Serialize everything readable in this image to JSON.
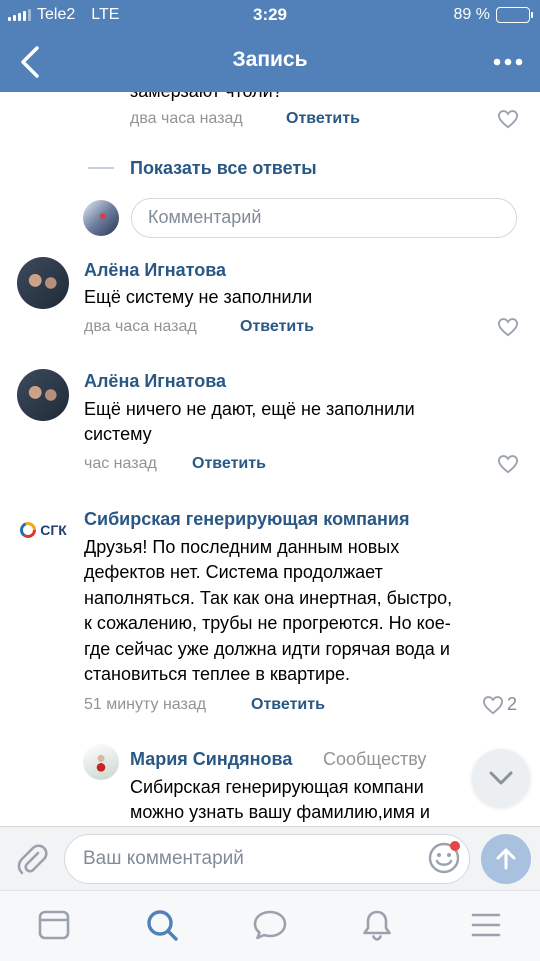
{
  "status_bar": {
    "carrier": "Tele2",
    "network": "LTE",
    "time": "3:29",
    "battery": "89 %",
    "battery_level": 0.89
  },
  "nav": {
    "title": "Запись"
  },
  "feed": {
    "top_partial": {
      "text": "замерзают чтоли?",
      "time": "два часа назад",
      "reply": "Ответить"
    },
    "show_all_replies": "Показать все ответы",
    "reply_placeholder": "Комментарий",
    "comments": [
      {
        "author": "Алёна Игнатова",
        "text": "Ещё систему не заполнили",
        "time": "два часа назад",
        "reply": "Ответить"
      },
      {
        "author": "Алёна Игнатова",
        "text_lines": [
          "Ещё ничего не дают, ещё не заполнили",
          "систему"
        ],
        "time": "час назад",
        "reply": "Ответить"
      },
      {
        "author": "Сибирская генерирующая компания",
        "logo_text": "СГК",
        "text_lines": [
          "Друзья! По последним данным новых",
          "дефектов нет. Система продолжает",
          "наполняться. Так как она инертная, быстро,",
          "к сожалению, трубы не прогреются. Но кое-",
          "где сейчас уже должна идти горячая вода и",
          "становиться теплее в квартире."
        ],
        "time": "51 минуту назад",
        "reply": "Ответить",
        "likes": "2"
      }
    ],
    "nested_reply": {
      "author": "Мария Синдянова",
      "to": "Сообществу",
      "text_lines": [
        "Сибирская генерирующая компани",
        "можно узнать вашу фамилию,имя и"
      ]
    }
  },
  "composer": {
    "placeholder": "Ваш комментарий"
  },
  "tabs": [
    "news-icon",
    "search-icon",
    "messages-icon",
    "notifications-icon",
    "menu-icon"
  ],
  "colors": {
    "header": "#5181b8",
    "link": "#2a5885",
    "meta": "#939393",
    "accent": "#5181b8"
  }
}
